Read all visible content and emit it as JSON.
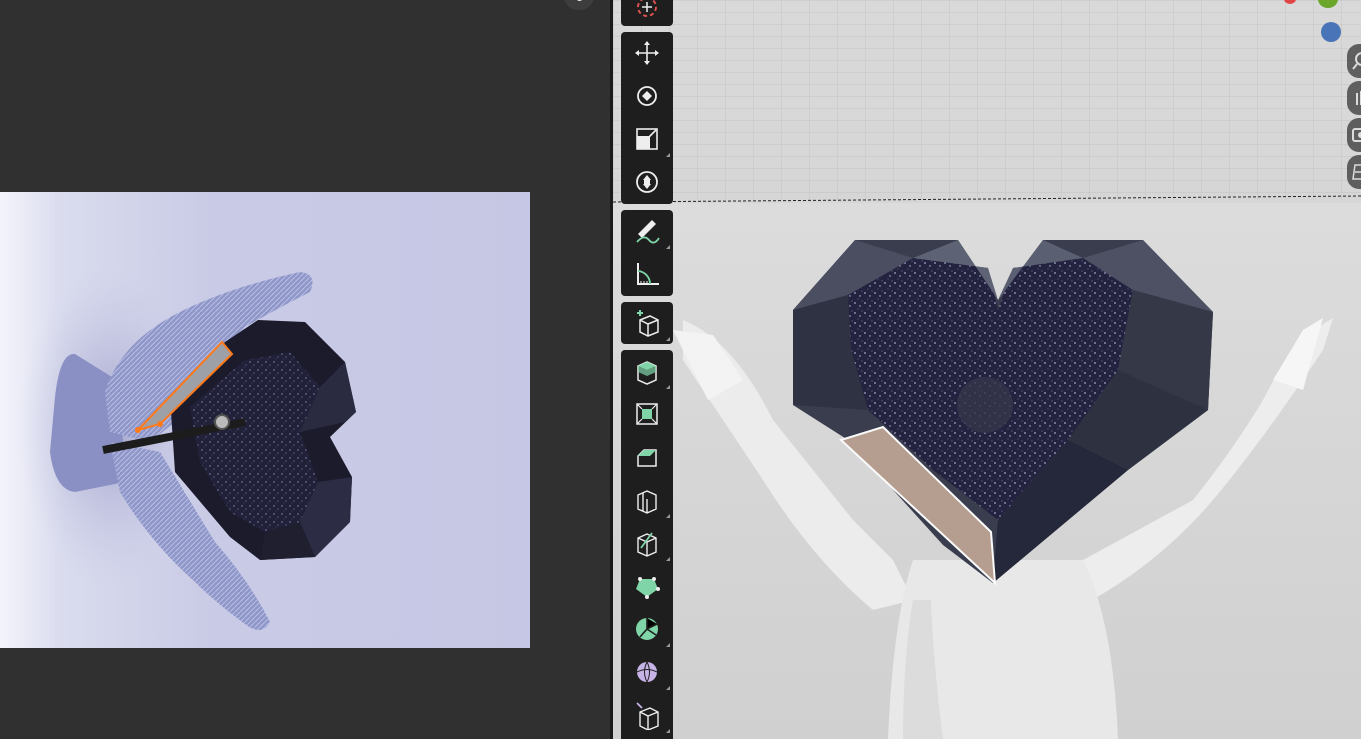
{
  "app": {
    "theme_bg": "#303030",
    "toolbar_bg": "#1e1e1e",
    "accent_green": "#7fd4a8"
  },
  "image_editor": {
    "reference_image": "hands-holding-heart-photo",
    "selection_color": "#ff7a1a"
  },
  "viewport": {
    "toolbar": {
      "groups": [
        {
          "tools": [
            "cursor-tool"
          ]
        },
        {
          "tools": [
            "move-tool",
            "rotate-tool",
            "scale-tool",
            "transform-tool"
          ]
        },
        {
          "tools": [
            "annotate-tool",
            "measure-tool"
          ]
        },
        {
          "tools": [
            "add-cube-tool"
          ]
        },
        {
          "tools": [
            "extrude-tool",
            "inset-tool",
            "bevel-tool",
            "loop-cut-tool",
            "knife-tool",
            "poly-build-tool",
            "spin-tool",
            "smooth-tool",
            "edge-slide-tool"
          ]
        }
      ]
    },
    "navigation_gizmo": {
      "buttons": [
        "zoom-icon",
        "pan-hand-icon",
        "camera-icon",
        "perspective-grid-icon"
      ],
      "axis_colors": {
        "x": "#e04545",
        "y": "#6aa62a",
        "z": "#4a74b8"
      }
    }
  }
}
